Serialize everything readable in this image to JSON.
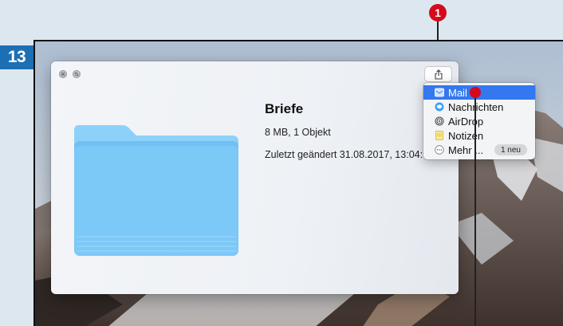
{
  "step_number": "13",
  "callout_number": "1",
  "window": {
    "title": "Briefe",
    "meta_size": "8 MB, 1 Objekt",
    "meta_modified": "Zuletzt geändert 31.08.2017, 13:04:"
  },
  "share_menu": {
    "items": [
      {
        "label": "Mail",
        "icon": "mail-icon",
        "selected": true
      },
      {
        "label": "Nachrichten",
        "icon": "messages-icon",
        "selected": false
      },
      {
        "label": "AirDrop",
        "icon": "airdrop-icon",
        "selected": false
      },
      {
        "label": "Notizen",
        "icon": "notes-icon",
        "selected": false
      },
      {
        "label": "Mehr ...",
        "icon": "more-icon",
        "selected": false,
        "badge": "1 neu"
      }
    ]
  },
  "colors": {
    "step_badge": "#1d6fb3",
    "callout": "#d40a1d",
    "selection": "#3478f0",
    "folder": "#7cc6f7"
  }
}
